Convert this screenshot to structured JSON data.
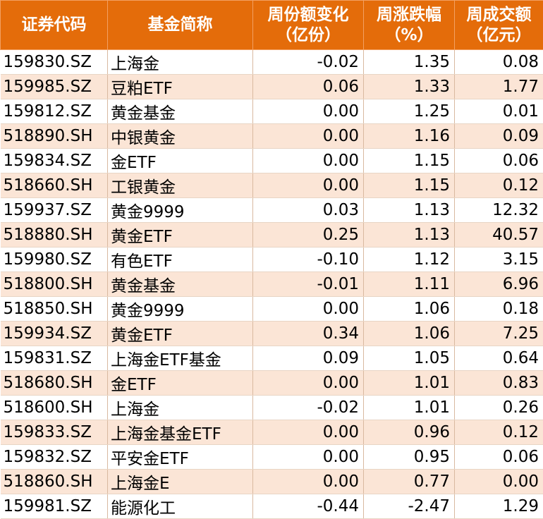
{
  "headers": {
    "code": "证券代码",
    "name": "基金简称",
    "share_change_line1": "周份额变化",
    "share_change_line2": "（亿份）",
    "weekly_change_line1": "周涨跌幅",
    "weekly_change_line2": "（%）",
    "turnover_line1": "周成交额",
    "turnover_line2": "（亿元）"
  },
  "rows": [
    {
      "code": "159830.SZ",
      "name": "上海金",
      "share_change": "-0.02",
      "weekly_change": "1.35",
      "turnover": "0.08"
    },
    {
      "code": "159985.SZ",
      "name": "豆粕ETF",
      "share_change": "0.06",
      "weekly_change": "1.33",
      "turnover": "1.77"
    },
    {
      "code": "159812.SZ",
      "name": "黄金基金",
      "share_change": "0.00",
      "weekly_change": "1.25",
      "turnover": "0.01"
    },
    {
      "code": "518890.SH",
      "name": "中银黄金",
      "share_change": "0.00",
      "weekly_change": "1.16",
      "turnover": "0.09"
    },
    {
      "code": "159834.SZ",
      "name": "金ETF",
      "share_change": "0.00",
      "weekly_change": "1.15",
      "turnover": "0.06"
    },
    {
      "code": "518660.SH",
      "name": "工银黄金",
      "share_change": "0.00",
      "weekly_change": "1.15",
      "turnover": "0.12"
    },
    {
      "code": "159937.SZ",
      "name": "黄金9999",
      "share_change": "0.03",
      "weekly_change": "1.13",
      "turnover": "12.32"
    },
    {
      "code": "518880.SH",
      "name": "黄金ETF",
      "share_change": "0.25",
      "weekly_change": "1.13",
      "turnover": "40.57"
    },
    {
      "code": "159980.SZ",
      "name": "有色ETF",
      "share_change": "-0.10",
      "weekly_change": "1.12",
      "turnover": "3.15"
    },
    {
      "code": "518800.SH",
      "name": "黄金基金",
      "share_change": "-0.01",
      "weekly_change": "1.11",
      "turnover": "6.96"
    },
    {
      "code": "518850.SH",
      "name": "黄金9999",
      "share_change": "0.00",
      "weekly_change": "1.06",
      "turnover": "0.18"
    },
    {
      "code": "159934.SZ",
      "name": "黄金ETF",
      "share_change": "0.34",
      "weekly_change": "1.06",
      "turnover": "7.25"
    },
    {
      "code": "159831.SZ",
      "name": "上海金ETF基金",
      "share_change": "0.09",
      "weekly_change": "1.05",
      "turnover": "0.64"
    },
    {
      "code": "518680.SH",
      "name": "金ETF",
      "share_change": "0.00",
      "weekly_change": "1.01",
      "turnover": "0.83"
    },
    {
      "code": "518600.SH",
      "name": "上海金",
      "share_change": "-0.02",
      "weekly_change": "1.01",
      "turnover": "0.26"
    },
    {
      "code": "159833.SZ",
      "name": "上海金基金ETF",
      "share_change": "0.00",
      "weekly_change": "0.96",
      "turnover": "0.12"
    },
    {
      "code": "159832.SZ",
      "name": "平安金ETF",
      "share_change": "0.00",
      "weekly_change": "0.95",
      "turnover": "0.06"
    },
    {
      "code": "518860.SH",
      "name": "上海金E",
      "share_change": "0.00",
      "weekly_change": "0.77",
      "turnover": "0.00"
    },
    {
      "code": "159981.SZ",
      "name": "能源化工",
      "share_change": "-0.44",
      "weekly_change": "-2.47",
      "turnover": "1.29"
    }
  ],
  "colors": {
    "header_bg": "#e46c0a",
    "header_text": "#ffffff",
    "row_alt_bg": "#fbe5d6",
    "row_bg": "#ffffff"
  }
}
